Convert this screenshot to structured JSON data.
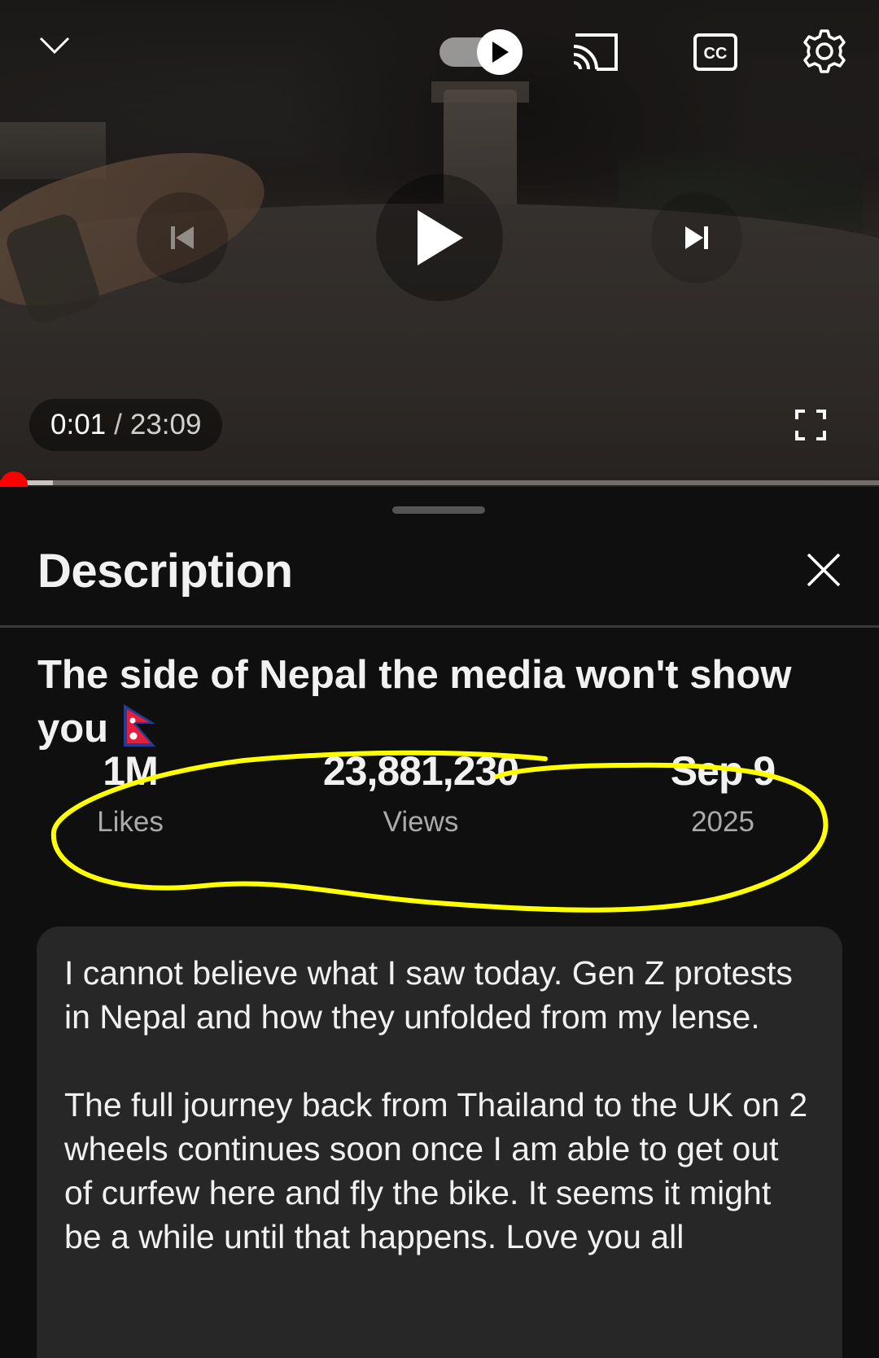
{
  "player": {
    "current_time": "0:01",
    "separator": "/",
    "duration": "23:09",
    "progress_fraction": 0.001,
    "buffer_fraction": 0.06,
    "autoplay_on": true,
    "icons": {
      "minimize": "chevron-down-icon",
      "autoplay": "autoplay-toggle-icon",
      "cast": "cast-icon",
      "captions": "cc-icon",
      "settings": "gear-icon",
      "previous": "skip-previous-icon",
      "play": "play-icon",
      "next": "skip-next-icon",
      "fullscreen": "fullscreen-icon"
    }
  },
  "sheet": {
    "title": "Description",
    "close_icon": "close-icon"
  },
  "video": {
    "title": "The side of Nepal the media won't show you",
    "title_emoji": "nepal-flag-icon"
  },
  "stats": {
    "likes": {
      "value": "1M",
      "label": "Likes"
    },
    "views": {
      "value": "23,881,230",
      "label": "Views"
    },
    "date": {
      "value": "Sep 9",
      "label": "2025"
    }
  },
  "description": {
    "paragraphs": [
      "I cannot believe what I saw today. Gen Z protests in Nepal and how they unfolded from my lense.",
      "The full journey back from Thailand to the UK on 2 wheels continues soon once I am able to get out of curfew here and fly the bike. It seems it might be a while until that happens. Love you all"
    ]
  },
  "colors": {
    "background": "#0f0f0f",
    "progress_played": "#ff0000",
    "annotation_highlight": "#ffff00",
    "description_box": "#272727"
  }
}
